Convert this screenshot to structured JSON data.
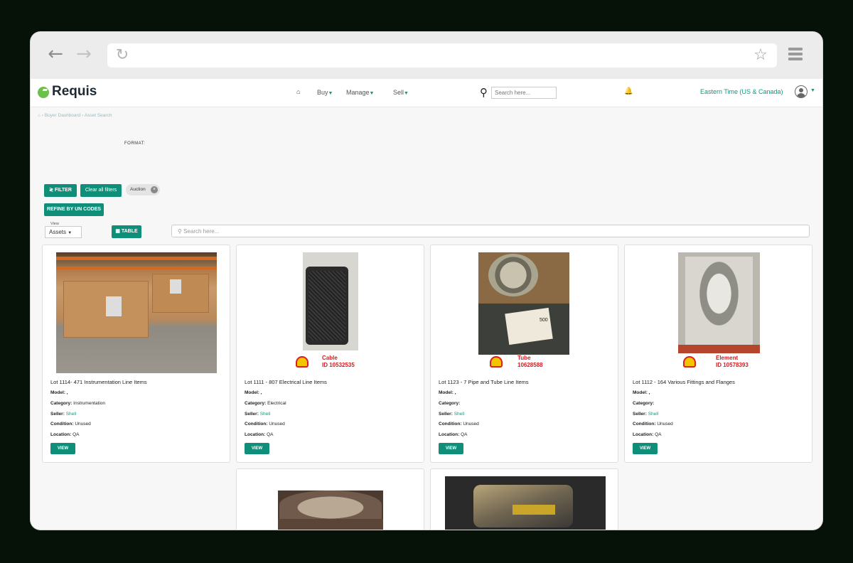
{
  "browser": {
    "url": ""
  },
  "app": {
    "logo": "Requis"
  },
  "nav": {
    "buy": "Buy",
    "manage": "Manage",
    "sell": "Sell"
  },
  "header": {
    "search_placeholder": "Search here...",
    "timezone": "Eastern Time (US & Canada)"
  },
  "breadcrumb": {
    "item1": "Buyer Dashboard",
    "item2": "Asset Search"
  },
  "filters": {
    "format_label": "FORMAT:",
    "filter_btn": "FILTER",
    "clear_btn": "Clear all filters",
    "chip": "Auction",
    "refine_btn": "REFINE BY UN CODES"
  },
  "view": {
    "label": "View",
    "selected": "Assets",
    "table_btn": "TABLE",
    "search_placeholder": "Search here..."
  },
  "cards": [
    {
      "title": "Lot 1114- 471 Instrumentation Line Items",
      "model": "Model: ,",
      "category_label": "Category:",
      "category": "Instrumentation",
      "seller_label": "Seller:",
      "seller": "Shell",
      "condition_label": "Condition:",
      "condition": "Unused",
      "location_label": "Location:",
      "location": "QA",
      "button": "VIEW"
    },
    {
      "title": "Lot 1111 - 807 Electrical Line Items",
      "model": "Model: ,",
      "category_label": "Category:",
      "category": "Electrical",
      "seller_label": "Seller:",
      "seller": "Shell",
      "condition_label": "Condition:",
      "condition": "Unused",
      "location_label": "Location:",
      "location": "QA",
      "button": "VIEW",
      "tag1": "Cable",
      "tag2": "ID 10532535"
    },
    {
      "title": "Lot 1123 - 7 Pipe and Tube Line Items",
      "model": "Model: ,",
      "category_label": "Category:",
      "category": "",
      "seller_label": "Seller:",
      "seller": "Shell",
      "condition_label": "Condition:",
      "condition": "Unused",
      "location_label": "Location:",
      "location": "QA",
      "button": "VIEW",
      "tag1": "Tube",
      "tag2": "10628588",
      "photo_tag": "500"
    },
    {
      "title": "Lot 1112 - 164 Various Fittings and Flanges",
      "model": "Model: ,",
      "category_label": "Category:",
      "category": "",
      "seller_label": "Seller:",
      "seller": "Shell",
      "condition_label": "Condition:",
      "condition": "Unused",
      "location_label": "Location:",
      "location": "QA",
      "button": "VIEW",
      "tag1": "Element",
      "tag2": "ID 10578393"
    }
  ]
}
